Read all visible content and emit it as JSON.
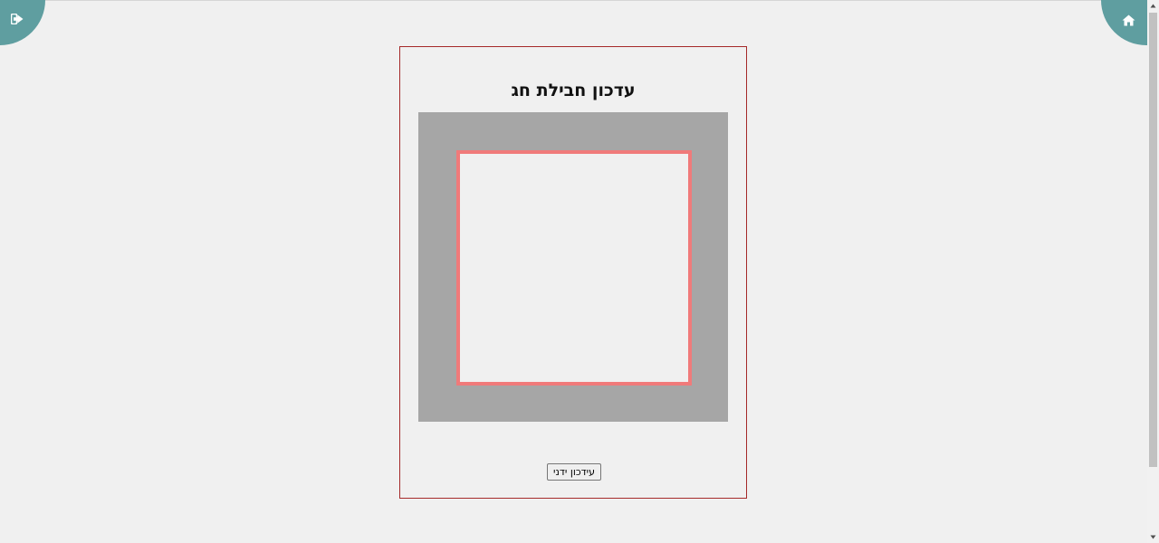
{
  "nav": {
    "logout_icon": "sign-out-icon",
    "home_icon": "home-icon",
    "accent_color": "#5f9ea0"
  },
  "card": {
    "title": "עדכון חבילת חג",
    "border_color": "#a52a2a"
  },
  "scanner": {
    "frame_color": "#a6a6a6",
    "region_border_color": "#f07a7a"
  },
  "actions": {
    "manual_update_label": "עידכון ידני"
  }
}
